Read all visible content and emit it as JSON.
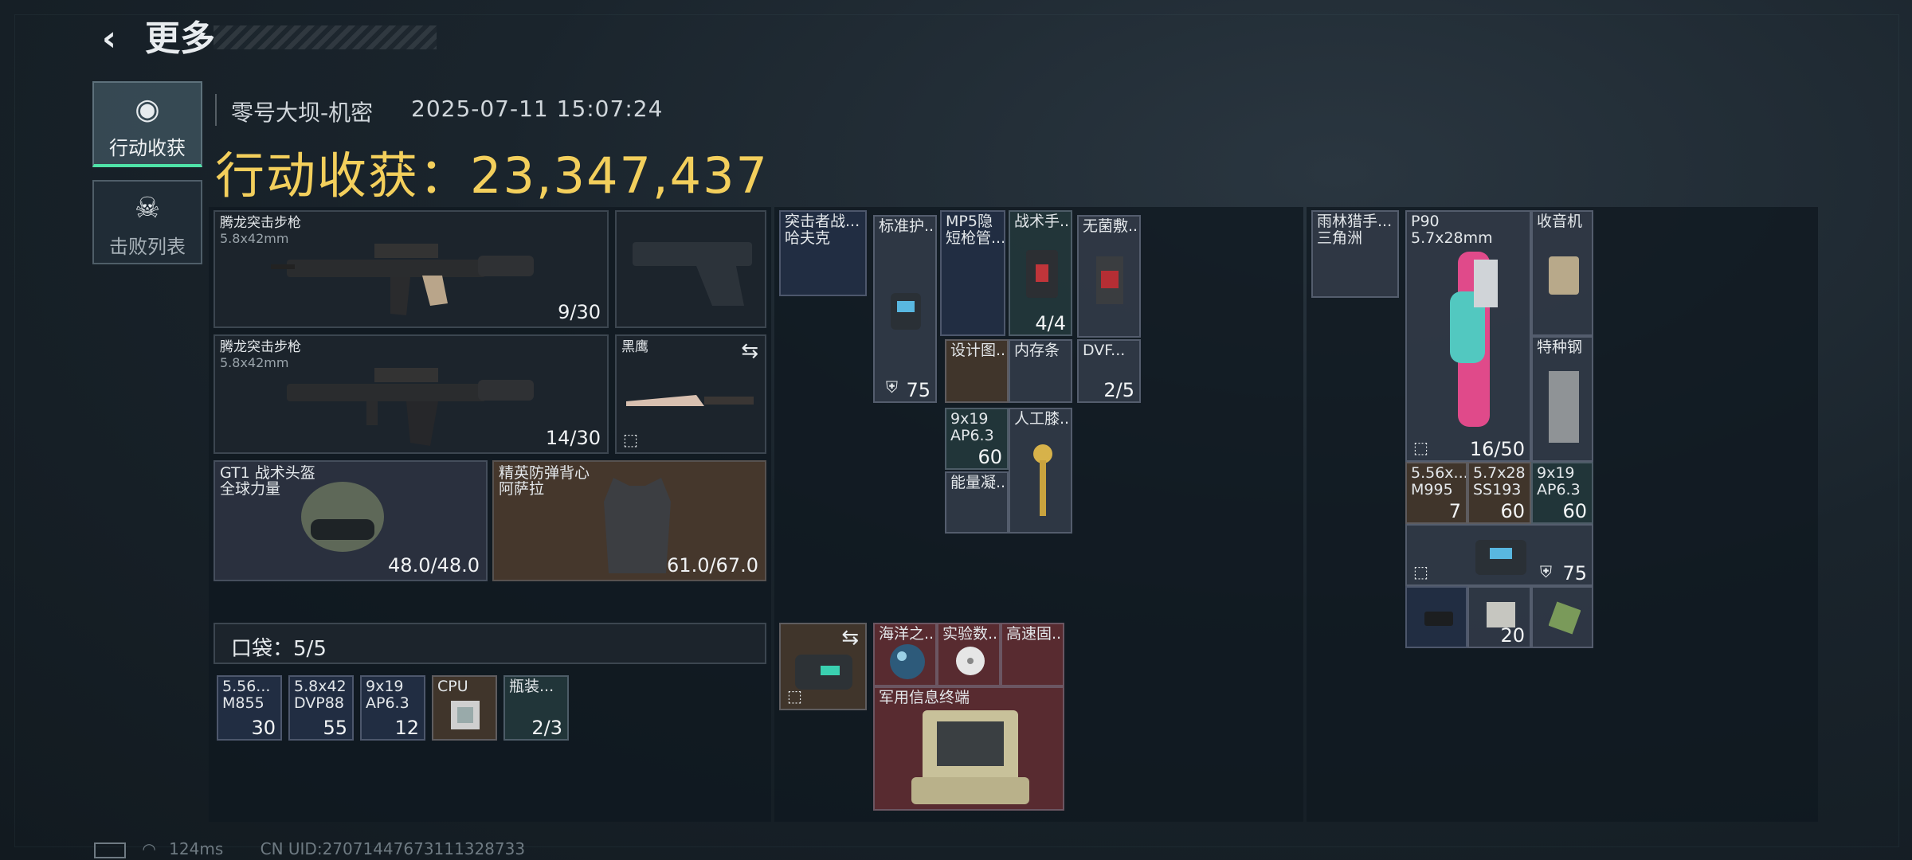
{
  "header": {
    "back_icon": "chevron-left-icon",
    "title": "更多"
  },
  "tabs": [
    {
      "label": "行动收获",
      "icon": "loot-icon",
      "active": true
    },
    {
      "label": "击败列表",
      "icon": "skull-icon",
      "active": false
    }
  ],
  "info": {
    "map": "零号大坝-机密",
    "timestamp": "2025-07-11 15:07:24",
    "earnings_label": "行动收获：",
    "earnings_value": "23,347,437"
  },
  "equipment": {
    "primary1": {
      "name": "腾龙突击步枪",
      "caliber": "5.8x42mm",
      "ammo": "9/30"
    },
    "primary2": {
      "name": "腾龙突击步枪",
      "caliber": "5.8x42mm",
      "ammo": "14/30"
    },
    "melee": {
      "name": "黑鹰"
    },
    "helmet": {
      "name": "GT1 战术头盔\n全球力量",
      "durability": "48.0/48.0"
    },
    "armor": {
      "name": "精英防弹背心\n阿萨拉",
      "durability": "61.0/67.0"
    }
  },
  "pocket": {
    "label": "口袋：",
    "count": "5/5",
    "items": [
      {
        "name": "5.56...\nM855",
        "qty": "30"
      },
      {
        "name": "5.8x42\nDVP88",
        "qty": "55"
      },
      {
        "name": "9x19\nAP6.3",
        "qty": "12"
      },
      {
        "name": "CPU",
        "qty": ""
      },
      {
        "name": "瓶装...",
        "qty": "2/3"
      }
    ]
  },
  "chest_rig": {
    "name": "突击者战...\n哈夫克",
    "items": [
      {
        "name": "标准护...",
        "qty": "75"
      },
      {
        "name": "MP5隐\n短枪管...",
        "qty": ""
      },
      {
        "name": "战术手...",
        "qty": "4/4"
      },
      {
        "name": "无菌敷...",
        "qty": ""
      },
      {
        "name": "设计图...",
        "qty": ""
      },
      {
        "name": "内存条",
        "qty": ""
      },
      {
        "name": "DVF...",
        "qty": "2/5"
      },
      {
        "name": "9x19\nAP6.3",
        "qty": "60"
      },
      {
        "name": "人工膝...",
        "qty": ""
      },
      {
        "name": "能量凝...",
        "qty": ""
      }
    ]
  },
  "backpack": {
    "items": [
      {
        "name": "海洋之...",
        "qty": ""
      },
      {
        "name": "实验数...",
        "qty": ""
      },
      {
        "name": "高速固...",
        "qty": ""
      },
      {
        "name": "军用信息终端",
        "qty": ""
      }
    ]
  },
  "safe_box": {
    "name": "雨林猎手...\n三角洲",
    "items": [
      {
        "name": "P90\n5.7x28mm",
        "qty": "16/50"
      },
      {
        "name": "收音机",
        "qty": ""
      },
      {
        "name": "特种钢",
        "qty": ""
      },
      {
        "name": "5.56x...\nM995",
        "qty": "7"
      },
      {
        "name": "5.7x28\nSS193",
        "qty": "60"
      },
      {
        "name": "9x19\nAP6.3",
        "qty": "60"
      },
      {
        "name": "",
        "qty": "75"
      },
      {
        "name": "",
        "qty": ""
      },
      {
        "name": "",
        "qty": "20"
      },
      {
        "name": "",
        "qty": ""
      }
    ]
  },
  "status": {
    "ping": "124ms",
    "uid": "CN UID:270714476731113287​33"
  }
}
